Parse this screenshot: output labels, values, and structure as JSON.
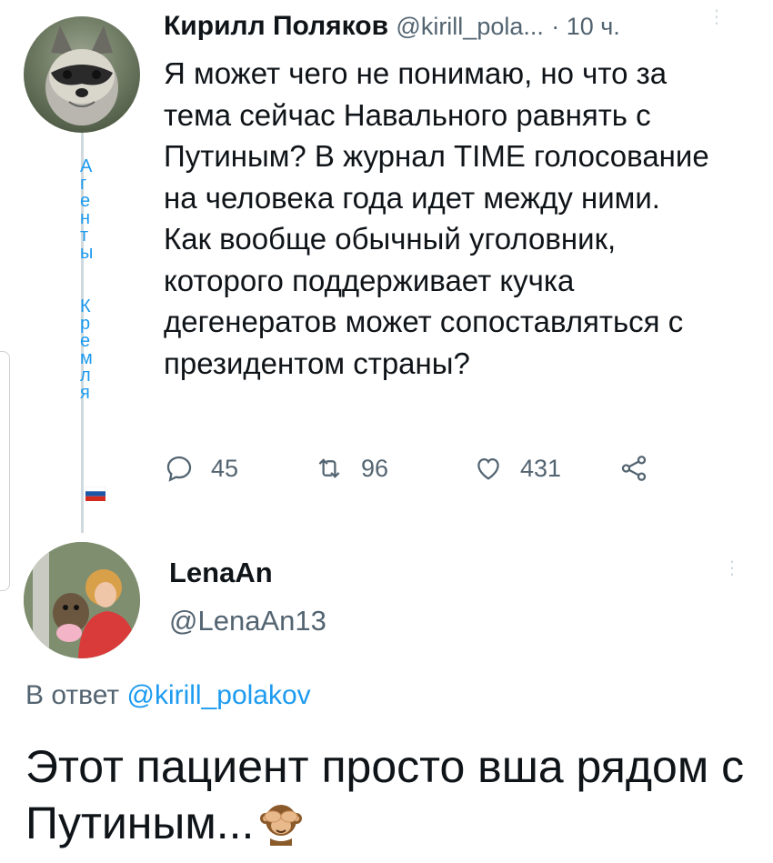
{
  "tweet1": {
    "author_name": "Кирилл Поляков",
    "handle": "@kirill_pola...",
    "time": "· 10 ч.",
    "text": "Я может чего не понимаю, но что за тема сейчас Навального равнять с Путиным? В журнал TIME голосование на человека года идет между ними. Как вообще обычный уголовник, которого поддерживает кучка дегенератов может сопоставляться с президентом страны?",
    "side_letters": [
      "А",
      "г",
      "е",
      "н",
      "т",
      "ы",
      "",
      "К",
      "р",
      "е",
      "м",
      "л",
      "я"
    ],
    "replies_count": "45",
    "retweets_count": "96",
    "likes_count": "431"
  },
  "tweet2": {
    "author_name": "LenaAn",
    "handle": "@LenaAn13",
    "reply_prefix": "В ответ",
    "reply_mention": "@kirill_polakov",
    "text": "Этот пациент просто вша рядом с Путиным..."
  },
  "icons": {
    "reply": "reply-icon",
    "retweet": "retweet-icon",
    "like": "heart-icon",
    "share": "share-icon",
    "more": "more-vertical-icon",
    "flag": "russian-flag-icon",
    "emoji": "see-no-evil-monkey-emoji"
  },
  "colors": {
    "accent": "#1d9bf0",
    "muted": "#536471",
    "text": "#0f1419",
    "divider": "#cfd9de"
  }
}
